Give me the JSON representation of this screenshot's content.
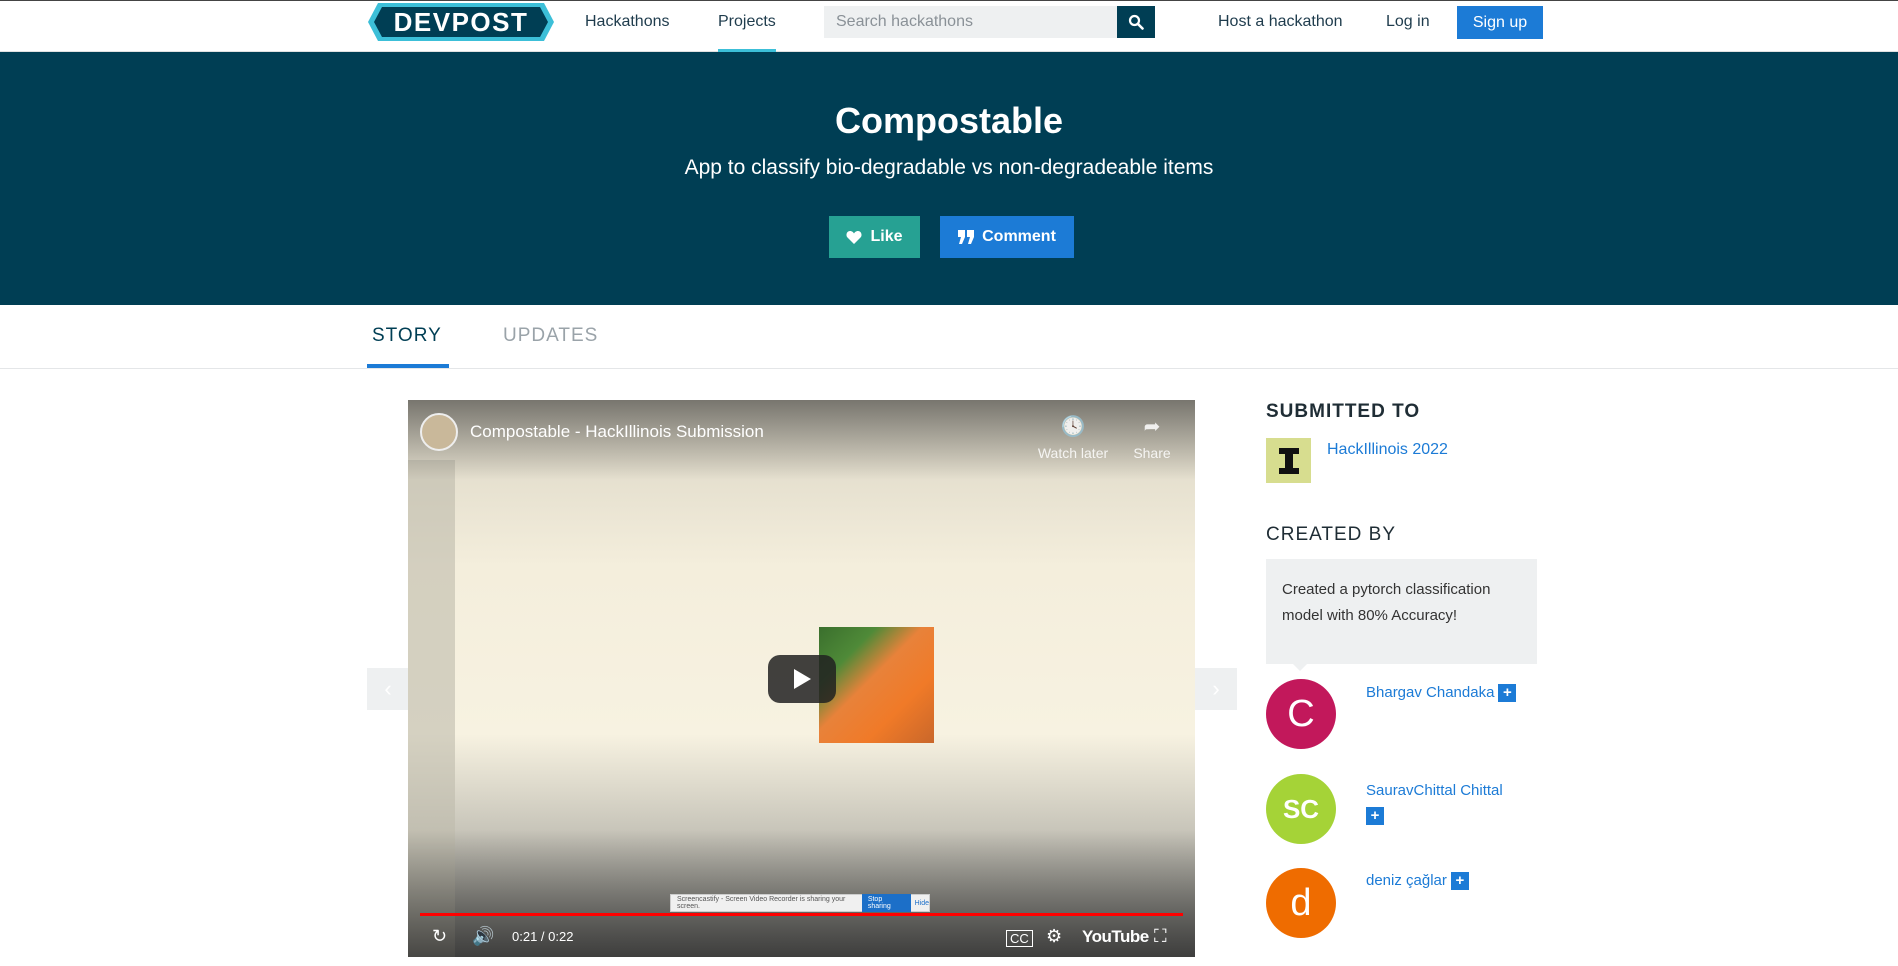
{
  "nav": {
    "logo_text": "DEVPOST",
    "links": [
      "Hackathons",
      "Projects"
    ],
    "search_placeholder": "Search hackathons",
    "host": "Host a hackathon",
    "login": "Log in",
    "signup": "Sign up"
  },
  "hero": {
    "title": "Compostable",
    "tagline": "App to classify bio-degradable vs non-degradeable items",
    "like": "Like",
    "comment": "Comment"
  },
  "tabs": [
    "STORY",
    "UPDATES"
  ],
  "video": {
    "title": "Compostable - HackIllinois Submission",
    "watch_later": "Watch later",
    "share": "Share",
    "time": "0:21 / 0:22",
    "youtube": "YouTube",
    "share_bar_text": "Screencastify - Screen Video Recorder is sharing your screen.",
    "share_bar_stop": "Stop sharing",
    "share_bar_hide": "Hide"
  },
  "sidebar": {
    "submitted_to": "SUBMITTED TO",
    "hackathon": "HackIllinois 2022",
    "created_by": "CREATED BY",
    "note": "Created a pytorch classification model with 80% Accuracy!",
    "members": [
      {
        "initial": "C",
        "name": "Bhargav Chandaka",
        "color": "#c2185b"
      },
      {
        "initial": "SC",
        "name": "SauravChittal Chittal",
        "color": "#a5d337"
      },
      {
        "initial": "d",
        "name": "deniz çağlar",
        "color": "#ef6c00"
      }
    ],
    "plus": "+"
  },
  "colors": {
    "brand": "#003e54",
    "accent": "#1c7bd6",
    "like": "#26a193"
  }
}
